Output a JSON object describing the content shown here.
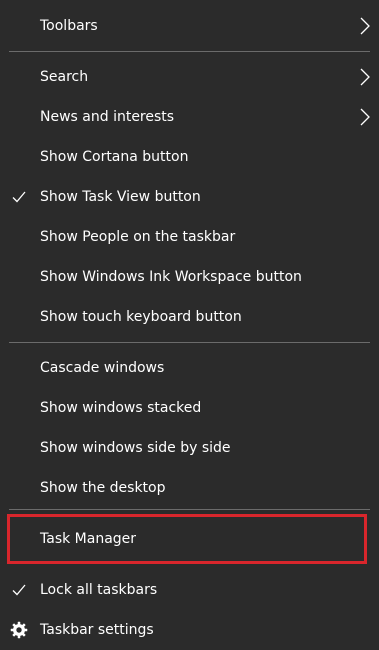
{
  "menu": {
    "toolbars": {
      "label": "Toolbars",
      "icon": "chevron-right-icon"
    },
    "search": {
      "label": "Search",
      "icon": "chevron-right-icon"
    },
    "news": {
      "label": "News and interests",
      "icon": "chevron-right-icon"
    },
    "cortana": {
      "label": "Show Cortana button"
    },
    "task_view": {
      "label": "Show Task View button",
      "checked": true,
      "icon": "checkmark-icon"
    },
    "people": {
      "label": "Show People on the taskbar"
    },
    "ink": {
      "label": "Show Windows Ink Workspace button"
    },
    "touch_keyboard": {
      "label": "Show touch keyboard button"
    },
    "cascade": {
      "label": "Cascade windows"
    },
    "stacked": {
      "label": "Show windows stacked"
    },
    "side_by_side": {
      "label": "Show windows side by side"
    },
    "desktop": {
      "label": "Show the desktop"
    },
    "task_manager": {
      "label": "Task Manager",
      "highlighted": true
    },
    "lock": {
      "label": "Lock all taskbars",
      "checked": true,
      "icon": "checkmark-icon"
    },
    "settings": {
      "label": "Taskbar settings",
      "icon": "gear-icon"
    }
  },
  "colors": {
    "background": "#2b2b2b",
    "text": "#ffffff",
    "separator": "#6b6b6b",
    "highlight_border": "#d9262c"
  }
}
